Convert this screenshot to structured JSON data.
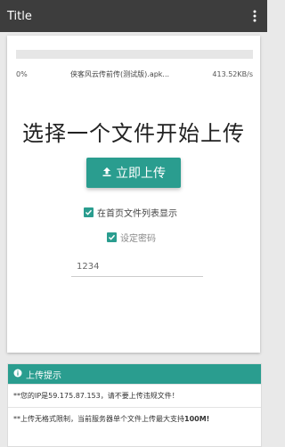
{
  "appbar": {
    "title": "Title",
    "menu_icon": "more-vert-icon"
  },
  "upload_progress": {
    "percent": 0,
    "percent_label": "0%",
    "filename": "侠客风云传前传(测试版).apk...",
    "speed": "413.52KB/s"
  },
  "main": {
    "headline": "选择一个文件开始上传",
    "upload_button": {
      "label": "立即上传",
      "icon": "upload-icon"
    },
    "options": [
      {
        "label": "在首页文件列表显示",
        "checked": true
      },
      {
        "label": "设定密码",
        "checked": true
      }
    ],
    "password_value": "1234"
  },
  "notice": {
    "title": "上传提示",
    "icon": "info-icon",
    "line1": "**您的IP是59.175.87.153，请不要上传违规文件！",
    "line2_prefix": "**上传无格式限制，当前服务器单个文件上传最大支持",
    "line2_bold": "100M!"
  },
  "colors": {
    "accent": "#2a9d8f",
    "appbar": "#3d3d3d"
  }
}
